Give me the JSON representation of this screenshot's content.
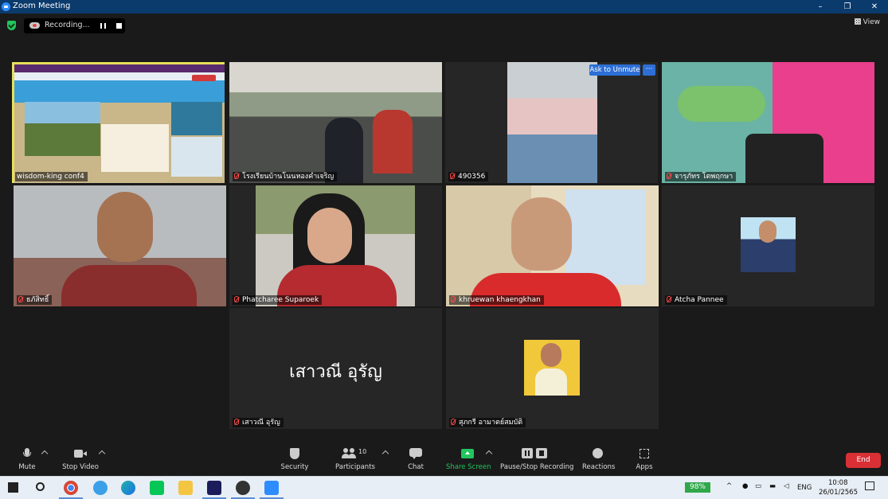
{
  "window": {
    "title": "Zoom Meeting",
    "controls": [
      "–",
      "❐",
      "✕"
    ]
  },
  "meeting_bar": {
    "recording_label": "Recording...",
    "view_label": "View"
  },
  "participants": [
    {
      "name": "wisdom-king conf4",
      "muted": false,
      "active_speaker": true
    },
    {
      "name": "โรงเรียนบ้านโนนหองคำเจริญ",
      "muted": true
    },
    {
      "name": "490356",
      "muted": true
    },
    {
      "name": "จารุภัทร  โตพฤกษา",
      "muted": true
    },
    {
      "name": "ธภัสิทธิ์",
      "muted": true
    },
    {
      "name": "Phatcharee Suparoek",
      "muted": true
    },
    {
      "name": "khruewan khaengkhan",
      "muted": true
    },
    {
      "name": "Atcha Pannee",
      "muted": true
    },
    {
      "name": "เสาวณี อุรัญ",
      "muted": true,
      "display_name_large": "เสาวณี อุรัญ"
    },
    {
      "name": "สุภกรี อามาตย์สมบัติ",
      "muted": true
    }
  ],
  "tile_buttons": {
    "ask_to_unmute": "Ask to Unmute",
    "more": "···"
  },
  "toolbar": {
    "mute": "Mute",
    "stop_video": "Stop Video",
    "security": "Security",
    "participants": "Participants",
    "participants_count": "10",
    "chat": "Chat",
    "share_screen": "Share Screen",
    "pause_stop_recording": "Pause/Stop Recording",
    "reactions": "Reactions",
    "apps": "Apps",
    "end": "End"
  },
  "taskbar": {
    "battery": "98%",
    "language": "ENG",
    "time": "10:08",
    "date": "26/01/2565",
    "apps": [
      "windows-start",
      "search",
      "chrome",
      "internet-explorer",
      "edge",
      "line",
      "file-explorer",
      "webex",
      "obs",
      "zoom"
    ]
  },
  "colors": {
    "accent_blue": "#2d8cff",
    "active_border": "#e6e05a",
    "share_green": "#23c55e",
    "end_red": "#d93036",
    "muted_red": "#ff4a4a"
  }
}
